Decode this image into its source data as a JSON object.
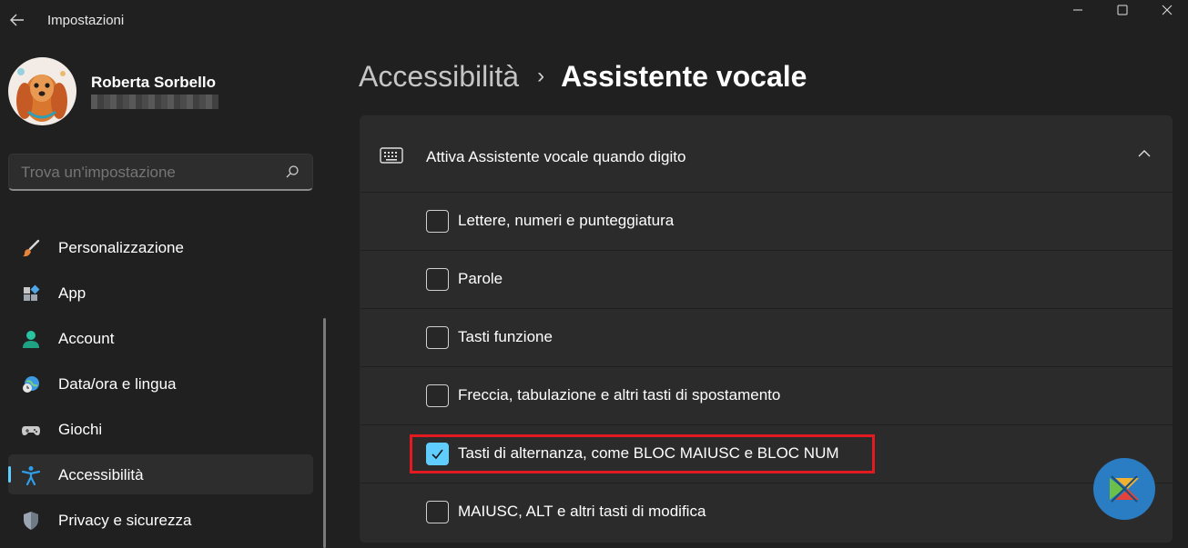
{
  "titlebar": {
    "app_title": "Impostazioni"
  },
  "profile": {
    "name": "Roberta Sorbello"
  },
  "search": {
    "placeholder": "Trova un'impostazione"
  },
  "sidebar": {
    "items": [
      {
        "label": "Personalizzazione",
        "icon": "brush-icon",
        "selected": false
      },
      {
        "label": "App",
        "icon": "apps-icon",
        "selected": false
      },
      {
        "label": "Account",
        "icon": "account-icon",
        "selected": false
      },
      {
        "label": "Data/ora e lingua",
        "icon": "globe-clock-icon",
        "selected": false
      },
      {
        "label": "Giochi",
        "icon": "gamepad-icon",
        "selected": false
      },
      {
        "label": "Accessibilità",
        "icon": "accessibility-icon",
        "selected": true
      },
      {
        "label": "Privacy e sicurezza",
        "icon": "shield-icon",
        "selected": false
      }
    ]
  },
  "header": {
    "breadcrumb_parent": "Accessibilità",
    "breadcrumb_current": "Assistente vocale"
  },
  "card": {
    "title": "Attiva Assistente vocale quando digito",
    "icon": "keyboard-icon",
    "expanded": true,
    "options": [
      {
        "label": "Lettere, numeri e punteggiatura",
        "checked": false
      },
      {
        "label": "Parole",
        "checked": false
      },
      {
        "label": "Tasti funzione",
        "checked": false
      },
      {
        "label": "Freccia, tabulazione e altri tasti di spostamento",
        "checked": false
      },
      {
        "label": "Tasti di alternanza, come BLOC MAIUSC e BLOC NUM",
        "checked": true
      },
      {
        "label": "MAIUSC, ALT e altri tasti di modifica",
        "checked": false
      }
    ]
  },
  "colors": {
    "background": "#202020",
    "card": "#2b2b2b",
    "accent": "#60cdff",
    "highlight": "#e31a1f"
  }
}
